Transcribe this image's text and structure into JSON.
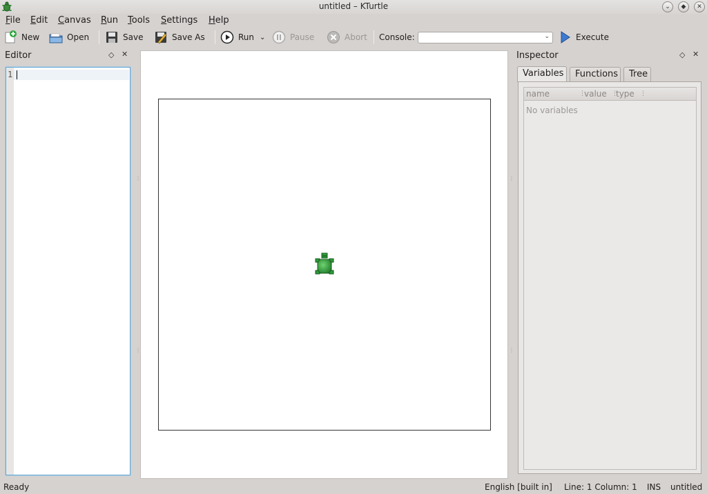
{
  "window": {
    "title": "untitled – KTurtle",
    "controls": [
      "minimize-icon",
      "maximize-icon",
      "close-icon"
    ]
  },
  "menu": [
    {
      "label": "File",
      "accel": "F"
    },
    {
      "label": "Edit",
      "accel": "E"
    },
    {
      "label": "Canvas",
      "accel": "C"
    },
    {
      "label": "Run",
      "accel": "R"
    },
    {
      "label": "Tools",
      "accel": "T"
    },
    {
      "label": "Settings",
      "accel": "S"
    },
    {
      "label": "Help",
      "accel": "H"
    }
  ],
  "toolbar": {
    "new_label": "New",
    "open_label": "Open",
    "save_label": "Save",
    "save_as_label": "Save As",
    "run_label": "Run",
    "pause_label": "Pause",
    "abort_label": "Abort",
    "console_label": "Console:",
    "console_value": "",
    "execute_label": "Execute"
  },
  "editor": {
    "title": "Editor",
    "line_numbers": [
      "1"
    ],
    "content": ""
  },
  "inspector": {
    "title": "Inspector",
    "tabs": [
      {
        "label": "Variables",
        "active": true
      },
      {
        "label": "Functions",
        "active": false
      },
      {
        "label": "Tree",
        "active": false
      }
    ],
    "columns": [
      "name",
      "value",
      "type"
    ],
    "empty_message": "No variables"
  },
  "status": {
    "message": "Ready",
    "language": "English [built in]",
    "position": "Line: 1 Column: 1",
    "mode": "INS",
    "filename": "untitled"
  },
  "colors": {
    "turtle": "#2f9a3a",
    "focus_border": "#5aa7d8",
    "window_bg": "#d6d2d0"
  }
}
